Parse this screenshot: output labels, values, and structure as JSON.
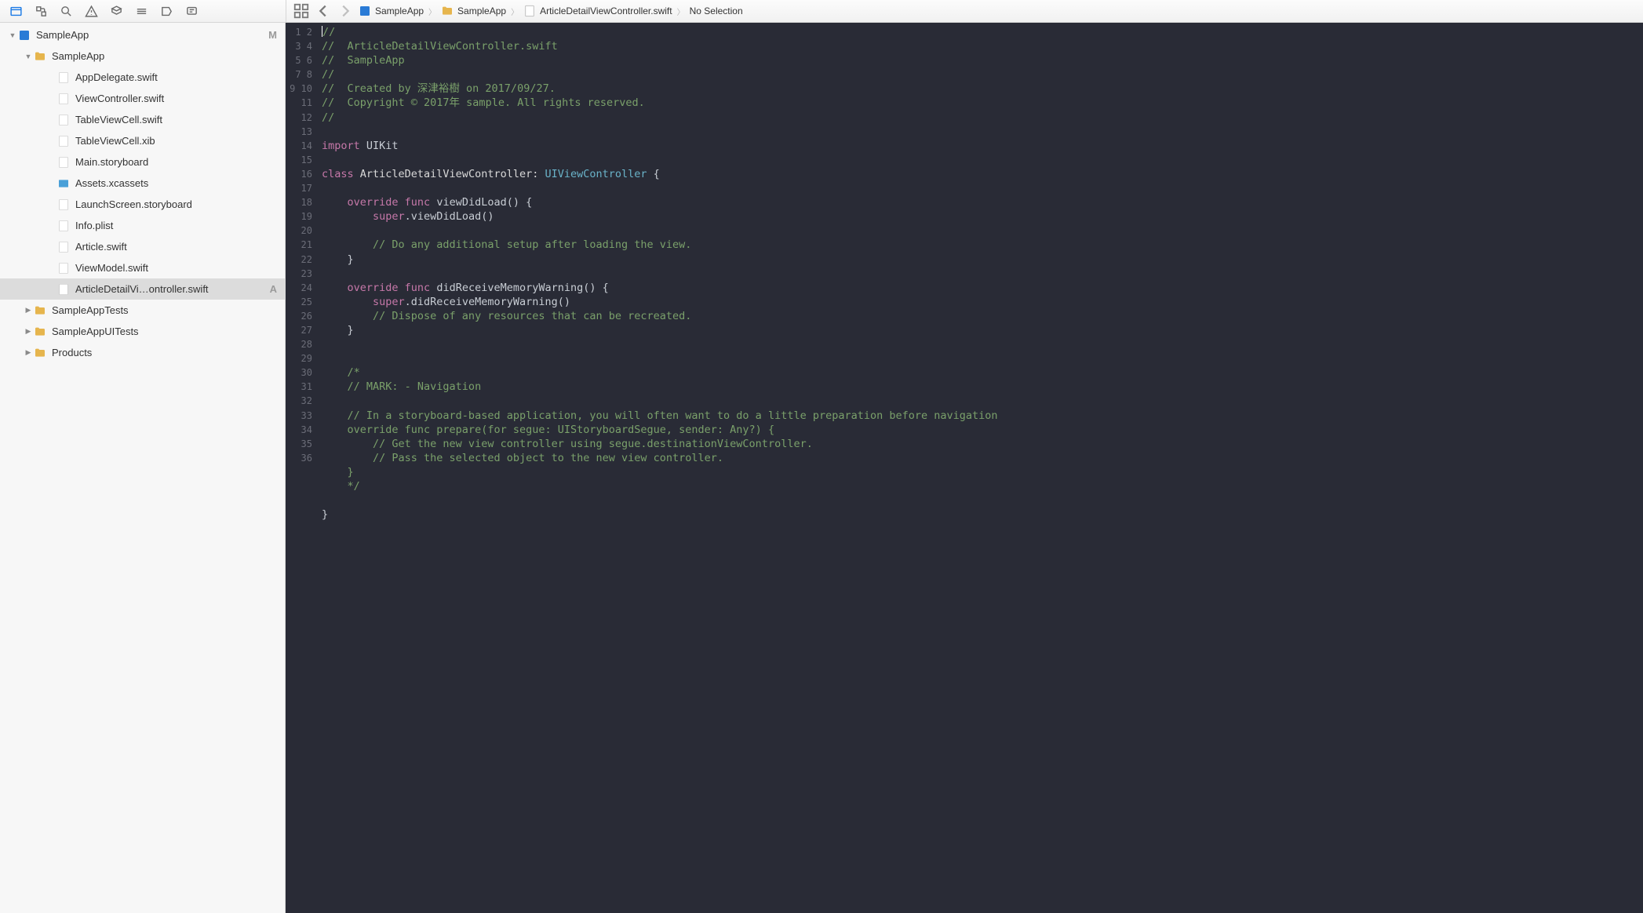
{
  "breadcrumb": {
    "b0": "SampleApp",
    "b1": "SampleApp",
    "b2": "ArticleDetailViewController.swift",
    "b3": "No Selection"
  },
  "navigator": {
    "root": {
      "label": "SampleApp",
      "status": "M"
    },
    "group": {
      "label": "SampleApp"
    },
    "files": {
      "f0": "AppDelegate.swift",
      "f1": "ViewController.swift",
      "f2": "TableViewCell.swift",
      "f3": "TableViewCell.xib",
      "f4": "Main.storyboard",
      "f5": "Assets.xcassets",
      "f6": "LaunchScreen.storyboard",
      "f7": "Info.plist",
      "f8": "Article.swift",
      "f9": "ViewModel.swift",
      "f10": "ArticleDetailVi…ontroller.swift"
    },
    "f10_status": "A",
    "g_tests": "SampleAppTests",
    "g_uitests": "SampleAppUITests",
    "g_products": "Products"
  },
  "code": {
    "l1": "//",
    "l2a": "//  ",
    "l2b": "ArticleDetailViewController.swift",
    "l3a": "//  ",
    "l3b": "SampleApp",
    "l4": "//",
    "l5": "//  Created by 深津裕樹 on 2017/09/27.",
    "l6": "//  Copyright © 2017年 sample. All rights reserved.",
    "l7": "//",
    "l8": "",
    "l9_kw": "import",
    "l9_mod": " UIKit",
    "l10": "",
    "l11_kw": "class",
    "l11_name": " ArticleDetailViewController: ",
    "l11_type": "UIViewController",
    "l11_end": " {",
    "l12": "",
    "l13_ind": "    ",
    "l13_kw": "override func",
    "l13_rest": " viewDidLoad() {",
    "l14_ind": "        ",
    "l14_kw": "super",
    "l14_rest": ".viewDidLoad()",
    "l15": "",
    "l16": "        // Do any additional setup after loading the view.",
    "l17": "    }",
    "l18": "",
    "l19_ind": "    ",
    "l19_kw": "override func",
    "l19_rest": " didReceiveMemoryWarning() {",
    "l20_ind": "        ",
    "l20_kw": "super",
    "l20_rest": ".didReceiveMemoryWarning()",
    "l21": "        // Dispose of any resources that can be recreated.",
    "l22": "    }",
    "l23": "",
    "l24": "",
    "l25": "    /*",
    "l26": "    // MARK: - Navigation",
    "l27": "",
    "l28": "    // In a storyboard-based application, you will often want to do a little preparation before navigation",
    "l29": "    override func prepare(for segue: UIStoryboardSegue, sender: Any?) {",
    "l30": "        // Get the new view controller using segue.destinationViewController.",
    "l31": "        // Pass the selected object to the new view controller.",
    "l32": "    }",
    "l33": "    */",
    "l34": "",
    "l35": "}",
    "l36": ""
  }
}
